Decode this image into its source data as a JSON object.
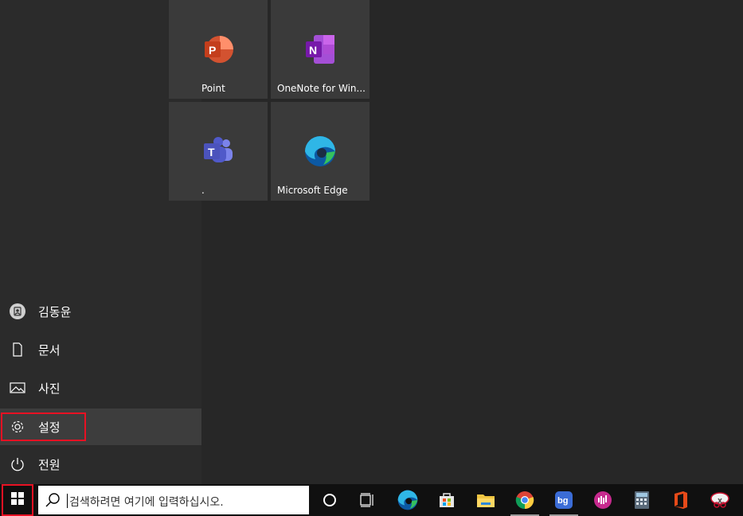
{
  "rail": {
    "user": "김동윤",
    "documents": "문서",
    "pictures": "사진",
    "settings": "설정",
    "power": "전원"
  },
  "tiles": {
    "powerpoint": "Point",
    "onenote": "OneNote for Win...",
    "teams": ".",
    "edge": "Microsoft Edge"
  },
  "taskbar": {
    "search_placeholder": "검색하려면 여기에 입력하십시오.",
    "icons": [
      "cortana-icon",
      "task-view-icon",
      "edge-icon",
      "store-icon",
      "file-explorer-icon",
      "chrome-icon",
      "bg-app-icon",
      "podcast-app-icon",
      "calculator-icon",
      "office-icon",
      "snipping-tool-icon"
    ]
  },
  "colors": {
    "highlight": "#e81123",
    "rail_bg": "#2b2b2b",
    "tile_bg": "#3a3a3a"
  }
}
